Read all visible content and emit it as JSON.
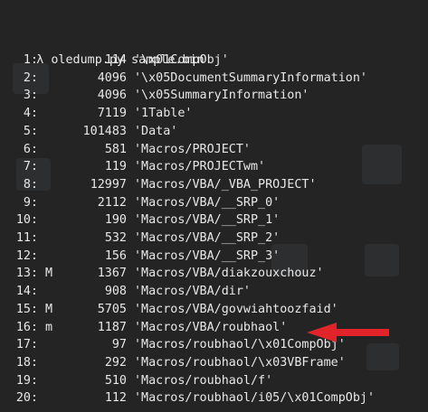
{
  "console": {
    "prompt_symbol": "λ",
    "command": "oledump.py sample.bin"
  },
  "streams": [
    {
      "index": "1:",
      "flag": "",
      "size": "114",
      "name": "'\\x01CompObj'"
    },
    {
      "index": "2:",
      "flag": "",
      "size": "4096",
      "name": "'\\x05DocumentSummaryInformation'"
    },
    {
      "index": "3:",
      "flag": "",
      "size": "4096",
      "name": "'\\x05SummaryInformation'"
    },
    {
      "index": "4:",
      "flag": "",
      "size": "7119",
      "name": "'1Table'"
    },
    {
      "index": "5:",
      "flag": "",
      "size": "101483",
      "name": "'Data'"
    },
    {
      "index": "6:",
      "flag": "",
      "size": "581",
      "name": "'Macros/PROJECT'"
    },
    {
      "index": "7:",
      "flag": "",
      "size": "119",
      "name": "'Macros/PROJECTwm'"
    },
    {
      "index": "8:",
      "flag": "",
      "size": "12997",
      "name": "'Macros/VBA/_VBA_PROJECT'"
    },
    {
      "index": "9:",
      "flag": "",
      "size": "2112",
      "name": "'Macros/VBA/__SRP_0'"
    },
    {
      "index": "10:",
      "flag": "",
      "size": "190",
      "name": "'Macros/VBA/__SRP_1'"
    },
    {
      "index": "11:",
      "flag": "",
      "size": "532",
      "name": "'Macros/VBA/__SRP_2'"
    },
    {
      "index": "12:",
      "flag": "",
      "size": "156",
      "name": "'Macros/VBA/__SRP_3'"
    },
    {
      "index": "13:",
      "flag": "M",
      "size": "1367",
      "name": "'Macros/VBA/diakzouxchouz'"
    },
    {
      "index": "14:",
      "flag": "",
      "size": "908",
      "name": "'Macros/VBA/dir'"
    },
    {
      "index": "15:",
      "flag": "M",
      "size": "5705",
      "name": "'Macros/VBA/govwiahtoozfaid'"
    },
    {
      "index": "16:",
      "flag": "m",
      "size": "1187",
      "name": "'Macros/VBA/roubhaol'"
    },
    {
      "index": "17:",
      "flag": "",
      "size": "97",
      "name": "'Macros/roubhaol/\\x01CompObj'"
    },
    {
      "index": "18:",
      "flag": "",
      "size": "292",
      "name": "'Macros/roubhaol/\\x03VBFrame'"
    },
    {
      "index": "19:",
      "flag": "",
      "size": "510",
      "name": "'Macros/roubhaol/f'"
    },
    {
      "index": "20:",
      "flag": "",
      "size": "112",
      "name": "'Macros/roubhaol/i05/\\x01CompObj'"
    }
  ],
  "annotation": {
    "arrow_color": "#e0242a",
    "points_to_stream": "16:"
  },
  "colors": {
    "background": "#242424",
    "text": "#e8e8e8",
    "arrow": "#e0242a"
  }
}
